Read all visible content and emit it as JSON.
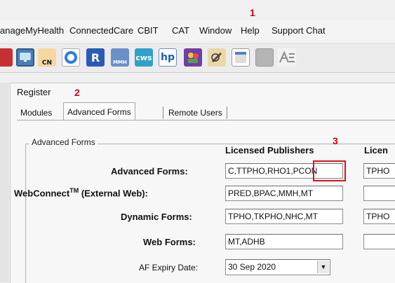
{
  "menu": {
    "items": [
      {
        "label": "anageMyHealth"
      },
      {
        "label": "ConnectedCare"
      },
      {
        "label": "CBIT"
      },
      {
        "label": "CAT"
      },
      {
        "label": "Window"
      },
      {
        "label": "Help"
      },
      {
        "label": "Support Chat"
      }
    ]
  },
  "annotations": {
    "one": "1",
    "two": "2",
    "three": "3"
  },
  "toolbar": {
    "icons": [
      {
        "name": "red-partial-icon"
      },
      {
        "name": "monitor-icon"
      },
      {
        "name": "cn-person-icon",
        "text": "CN"
      },
      {
        "name": "globe-icon"
      },
      {
        "name": "r-icon",
        "text": "R"
      },
      {
        "name": "mmh-icon",
        "text": "MMH"
      },
      {
        "name": "cws-icon",
        "text": "cws"
      },
      {
        "name": "hp-icon",
        "text": "hp"
      },
      {
        "name": "people-icon"
      },
      {
        "name": "pencil-icon"
      },
      {
        "name": "window-icon"
      },
      {
        "name": "gray-square-icon"
      },
      {
        "name": "ae-icon"
      }
    ]
  },
  "dialog": {
    "title": "Register",
    "tabs": [
      {
        "label": "Modules"
      },
      {
        "label": "Advanced Forms"
      },
      {
        "label": "Remote Users"
      }
    ],
    "group_label": "Advanced Forms",
    "columns": [
      "Licensed Publishers",
      "Licen"
    ],
    "rows": [
      {
        "label": "Advanced Forms:",
        "value": "C,TTPHO,RHO1,PCON",
        "value2": "TPHO"
      },
      {
        "label": "WebConnect",
        "label_sup": "TM",
        "label_rest": " (External Web):",
        "value": "PRED,BPAC,MMH,MT",
        "value2": ""
      },
      {
        "label": "Dynamic Forms:",
        "value": "TPHO,TKPHO,NHC,MT",
        "value2": "TPHO"
      },
      {
        "label": "Web Forms:",
        "value": "MT,ADHB",
        "value2": ""
      }
    ],
    "expiry_label": "AF Expiry Date:",
    "expiry_value": "30 Sep 2020"
  },
  "colors": {
    "annotation": "#d0021b",
    "highlight_box": "#e0121b"
  }
}
